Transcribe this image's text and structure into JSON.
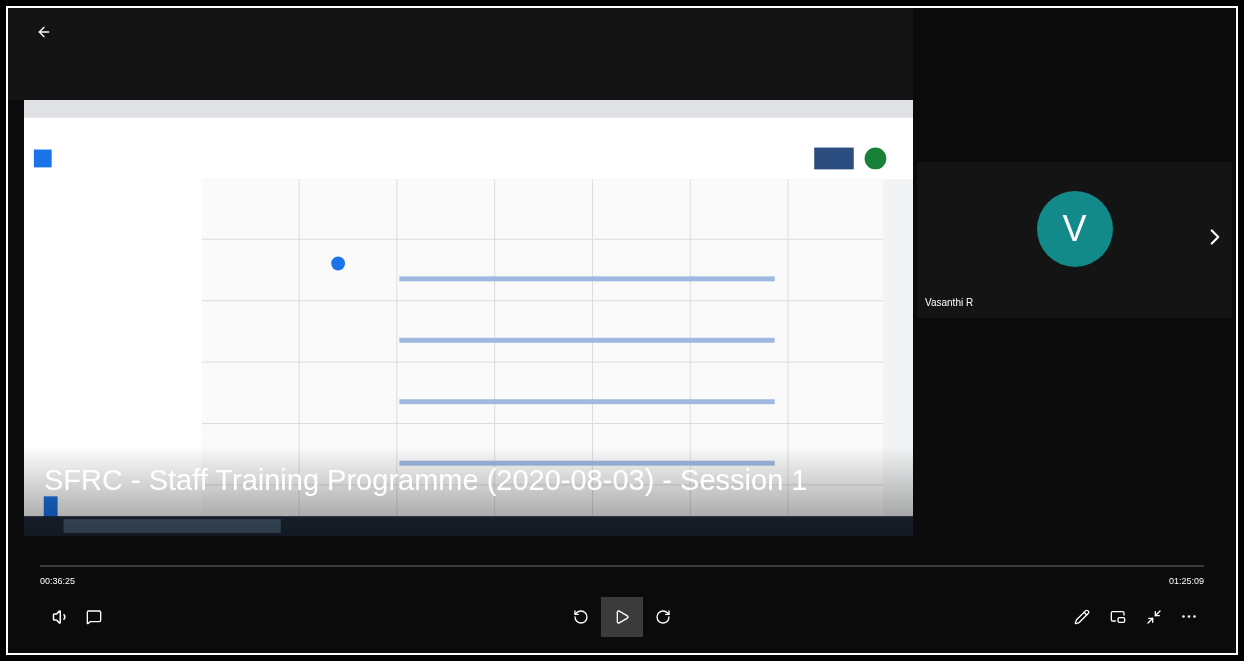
{
  "video": {
    "title": "SFRC - Staff Training Programme (2020-08-03) - Session 1"
  },
  "participant": {
    "initial": "V",
    "name": "Vasanthi R"
  },
  "player": {
    "elapsed": "00:36:25",
    "duration": "01:25:09",
    "playing": false
  }
}
